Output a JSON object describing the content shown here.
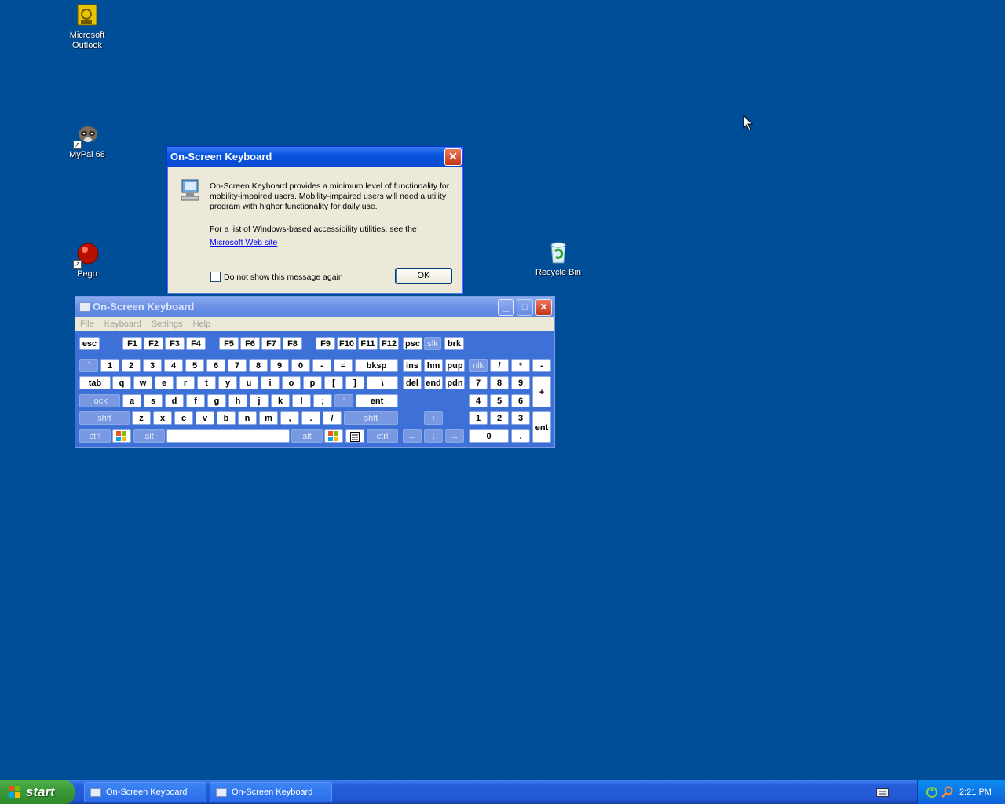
{
  "desktop": {
    "icons": [
      {
        "label": "Microsoft Outlook"
      },
      {
        "label": "MyPal 68"
      },
      {
        "label": "Pego"
      },
      {
        "label": "Recycle Bin"
      }
    ]
  },
  "dialog": {
    "title": "On-Screen Keyboard",
    "close_label": "✕",
    "paragraph1": "On-Screen Keyboard provides a minimum level of functionality for mobility-impaired users. Mobility-impaired users will need a utility program with higher functionality for daily use.",
    "paragraph2": "For a list of Windows-based accessibility utilities, see the",
    "link_text": "Microsoft Web site",
    "checkbox_label": "Do not show this message again",
    "ok_label": "OK"
  },
  "osk": {
    "title": "On-Screen Keyboard",
    "menu": [
      "File",
      "Keyboard",
      "Settings",
      "Help"
    ],
    "keys": {
      "esc": "esc",
      "f": [
        "F1",
        "F2",
        "F3",
        "F4",
        "F5",
        "F6",
        "F7",
        "F8",
        "F9",
        "F10",
        "F11",
        "F12"
      ],
      "psc": "psc",
      "slk": "slk",
      "brk": "brk",
      "row1": [
        "`",
        "1",
        "2",
        "3",
        "4",
        "5",
        "6",
        "7",
        "8",
        "9",
        "0",
        "-",
        "="
      ],
      "bksp": "bksp",
      "ins": "ins",
      "hm": "hm",
      "pup": "pup",
      "nlk": "nlk",
      "div": "/",
      "mul": "*",
      "sub": "-",
      "tab": "tab",
      "row2": [
        "q",
        "w",
        "e",
        "r",
        "t",
        "y",
        "u",
        "i",
        "o",
        "p",
        "[",
        "]",
        "\\"
      ],
      "del": "del",
      "end": "end",
      "pdn": "pdn",
      "n789": [
        "7",
        "8",
        "9"
      ],
      "plus": "+",
      "lock": "lock",
      "row3": [
        "a",
        "s",
        "d",
        "f",
        "g",
        "h",
        "j",
        "k",
        "l",
        ";",
        "'"
      ],
      "ent": "ent",
      "n456": [
        "4",
        "5",
        "6"
      ],
      "shft": "shft",
      "row4": [
        "z",
        "x",
        "c",
        "v",
        "b",
        "n",
        "m",
        ",",
        ".",
        "/"
      ],
      "up": "↑",
      "n123": [
        "1",
        "2",
        "3"
      ],
      "nent": "ent",
      "ctrl": "ctrl",
      "alt": "alt",
      "left": "←",
      "down": "↓",
      "right": "→",
      "n0": "0",
      "ndot": "."
    }
  },
  "taskbar": {
    "start_label": "start",
    "tasks": [
      "On-Screen Keyboard",
      "On-Screen Keyboard"
    ],
    "clock": "2:21 PM"
  }
}
